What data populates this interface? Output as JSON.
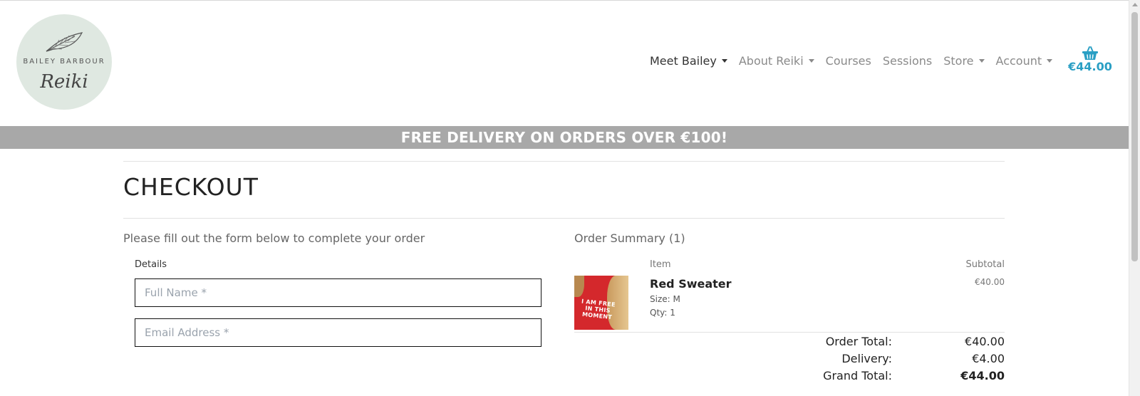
{
  "brand": {
    "name_top": "BAILEY BARBOUR",
    "name_script": "Reiki",
    "logo_bg": "#dfe8e1"
  },
  "nav": {
    "items": [
      {
        "label": "Meet Bailey",
        "dropdown": true,
        "active": true
      },
      {
        "label": "About Reiki",
        "dropdown": true,
        "active": false
      },
      {
        "label": "Courses",
        "dropdown": false,
        "active": false
      },
      {
        "label": "Sessions",
        "dropdown": false,
        "active": false
      },
      {
        "label": "Store",
        "dropdown": true,
        "active": false
      },
      {
        "label": "Account",
        "dropdown": true,
        "active": false
      }
    ],
    "cart": {
      "icon": "basket-icon",
      "amount": "€44.00",
      "color": "#2a9fc4"
    }
  },
  "banner": {
    "text": "FREE DELIVERY ON ORDERS OVER €100!",
    "bg": "#a8a8a8"
  },
  "page": {
    "title": "CHECKOUT"
  },
  "form": {
    "intro": "Please fill out the form below to complete your order",
    "details_label": "Details",
    "full_name": {
      "value": "",
      "placeholder": "Full Name *"
    },
    "email": {
      "value": "",
      "placeholder": "Email Address *"
    }
  },
  "summary": {
    "title": "Order Summary (1)",
    "col_item": "Item",
    "col_subtotal": "Subtotal",
    "items": [
      {
        "name": "Red Sweater",
        "size": "Size: M",
        "qty": "Qty: 1",
        "subtotal": "€40.00",
        "image_text": "I AM FREE IN THIS MOMENT"
      }
    ],
    "totals": [
      {
        "label": "Order Total:",
        "value": "€40.00"
      },
      {
        "label": "Delivery:",
        "value": "€4.00"
      },
      {
        "label": "Grand Total:",
        "value": "€44.00"
      }
    ]
  }
}
